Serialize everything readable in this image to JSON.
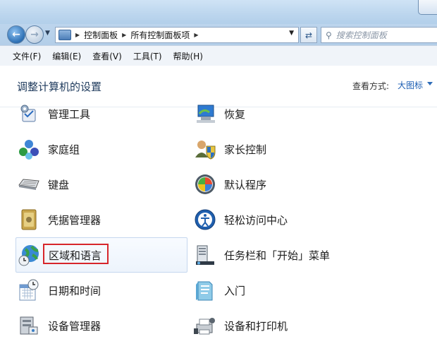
{
  "navigation": {
    "breadcrumbs": [
      "控制面板",
      "所有控制面板项"
    ],
    "search_placeholder": "搜索控制面板"
  },
  "menu": [
    "文件(F)",
    "编辑(E)",
    "查看(V)",
    "工具(T)",
    "帮助(H)"
  ],
  "header": {
    "title": "调整计算机的设置",
    "view_label": "查看方式:",
    "view_value": "大图标"
  },
  "items_left": [
    {
      "label": "管理工具",
      "icon": "admin-tools-icon"
    },
    {
      "label": "家庭组",
      "icon": "homegroup-icon"
    },
    {
      "label": "键盘",
      "icon": "keyboard-icon"
    },
    {
      "label": "凭据管理器",
      "icon": "credential-manager-icon"
    },
    {
      "label": "区域和语言",
      "icon": "region-language-icon"
    },
    {
      "label": "日期和时间",
      "icon": "date-time-icon"
    },
    {
      "label": "设备管理器",
      "icon": "device-manager-icon"
    }
  ],
  "items_right": [
    {
      "label": "恢复",
      "icon": "recovery-icon"
    },
    {
      "label": "家长控制",
      "icon": "parental-controls-icon"
    },
    {
      "label": "默认程序",
      "icon": "default-programs-icon"
    },
    {
      "label": "轻松访问中心",
      "icon": "ease-of-access-icon"
    },
    {
      "label": "任务栏和「开始」菜单",
      "icon": "taskbar-start-menu-icon"
    },
    {
      "label": "入门",
      "icon": "getting-started-icon"
    },
    {
      "label": "设备和打印机",
      "icon": "devices-printers-icon"
    }
  ],
  "colors": {
    "highlight": "#d7262b",
    "link": "#1c5eb3"
  }
}
